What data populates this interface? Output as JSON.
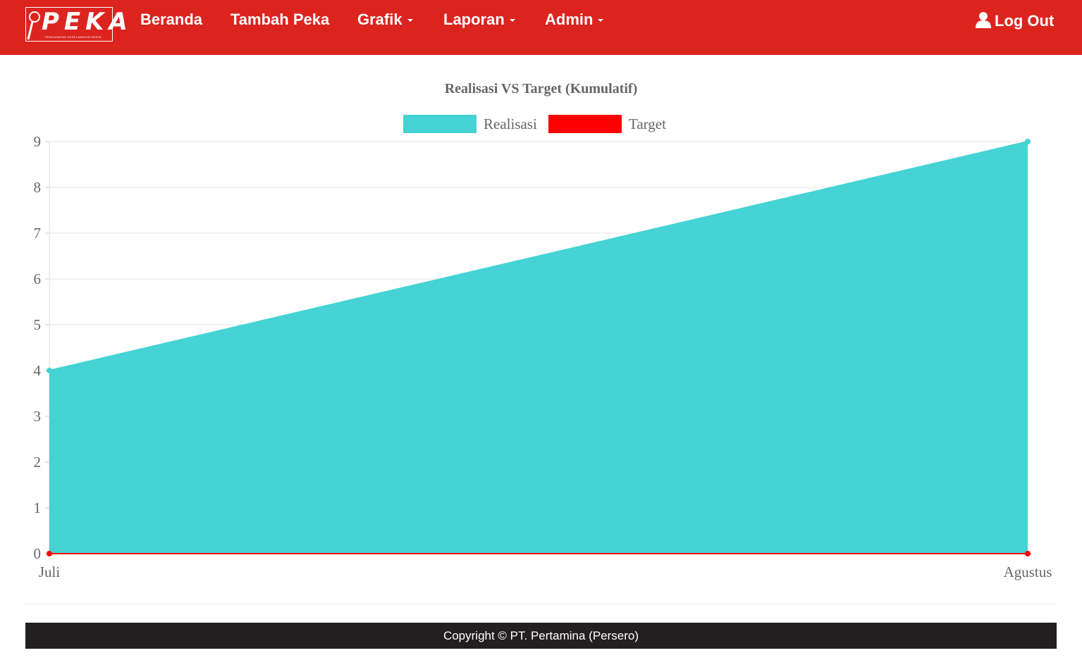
{
  "navbar": {
    "brand": "PEKA",
    "brand_subtitle": "PENGAMATAN KESELAMATAN KERJA",
    "items": [
      {
        "label": "Beranda",
        "dropdown": false
      },
      {
        "label": "Tambah Peka",
        "dropdown": false
      },
      {
        "label": "Grafik",
        "dropdown": true
      },
      {
        "label": "Laporan",
        "dropdown": true
      },
      {
        "label": "Admin",
        "dropdown": true
      }
    ],
    "logout_label": "Log Out",
    "logout_icon": "user-icon"
  },
  "colors": {
    "navbar": "#dc241f",
    "realisasi": "#45d3d5",
    "target": "#ff0000",
    "footer": "#231f20"
  },
  "chart_data": {
    "type": "area",
    "title": "Realisasi VS Target (Kumulatif)",
    "categories": [
      "Juli",
      "Agustus"
    ],
    "series": [
      {
        "name": "Realisasi",
        "values": [
          4,
          9
        ],
        "color": "#45d3d5"
      },
      {
        "name": "Target",
        "values": [
          0,
          0
        ],
        "color": "#ff0000"
      }
    ],
    "ylim": [
      0,
      9
    ],
    "yticks": [
      0,
      1,
      2,
      3,
      4,
      5,
      6,
      7,
      8,
      9
    ],
    "grid": true,
    "legend": "top-center"
  },
  "footer": {
    "text": "Copyright © PT. Pertamina (Persero)"
  }
}
